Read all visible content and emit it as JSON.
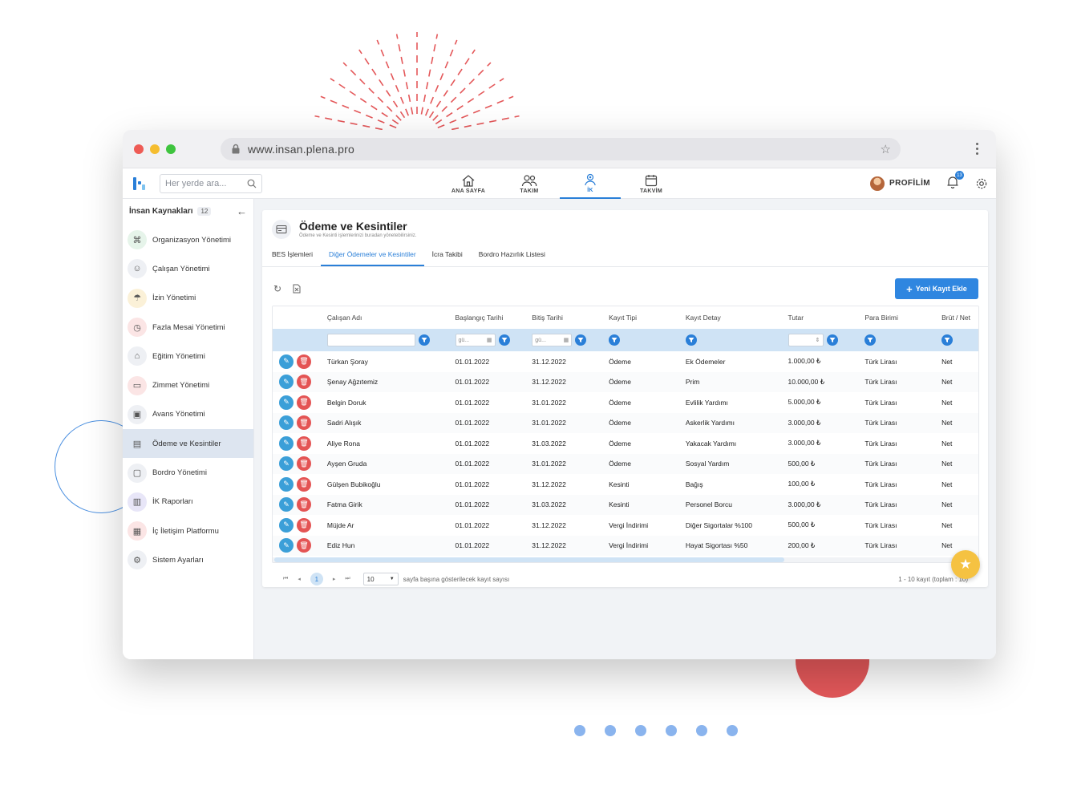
{
  "browser": {
    "url": "www.insan.plena.pro",
    "traffic_colors": [
      "#ee5b55",
      "#f5bd2f",
      "#3ec43e"
    ]
  },
  "search": {
    "placeholder": "Her yerde ara..."
  },
  "nav": {
    "items": [
      {
        "label": "ANA SAYFA",
        "icon": "home-icon",
        "active": false
      },
      {
        "label": "TAKIM",
        "icon": "team-icon",
        "active": false
      },
      {
        "label": "İK",
        "icon": "hr-icon",
        "active": true
      },
      {
        "label": "TAKVİM",
        "icon": "calendar-icon",
        "active": false
      }
    ]
  },
  "header": {
    "profile_label": "PROFİLİM",
    "notification_count": "13"
  },
  "sidebar": {
    "title": "İnsan Kaynakları",
    "count": "12",
    "items": [
      {
        "label": "Organizasyon Yönetimi",
        "icon": "org-chart-icon"
      },
      {
        "label": "Çalışan Yönetimi",
        "icon": "employees-icon"
      },
      {
        "label": "İzin Yönetimi",
        "icon": "umbrella-icon"
      },
      {
        "label": "Fazla Mesai Yönetimi",
        "icon": "clock-icon"
      },
      {
        "label": "Eğitim Yönetimi",
        "icon": "graduation-cap-icon"
      },
      {
        "label": "Zimmet Yönetimi",
        "icon": "devices-icon"
      },
      {
        "label": "Avans Yönetimi",
        "icon": "cash-icon"
      },
      {
        "label": "Ödeme ve Kesintiler",
        "icon": "payment-card-icon",
        "active": true
      },
      {
        "label": "Bordro Yönetimi",
        "icon": "payroll-icon"
      },
      {
        "label": "İK Raporları",
        "icon": "bar-chart-icon"
      },
      {
        "label": "İç İletişim Platformu",
        "icon": "communication-icon"
      },
      {
        "label": "Sistem Ayarları",
        "icon": "gear-icon"
      }
    ]
  },
  "page": {
    "title": "Ödeme ve Kesintiler",
    "subtitle": "Ödeme ve Kesinti işlemlerinizi buradan yönetebilirsiniz.",
    "tabs": [
      {
        "label": "BES İşlemleri",
        "active": false
      },
      {
        "label": "Diğer Ödemeler ve Kesintiler",
        "active": true
      },
      {
        "label": "İcra Takibi",
        "active": false
      },
      {
        "label": "Bordro Hazırlık Listesi",
        "active": false
      }
    ],
    "add_button": "Yeni Kayıt Ekle"
  },
  "table": {
    "columns": [
      "Çalışan Adı",
      "Başlangıç Tarihi",
      "Bitiş Tarihi",
      "Kayıt Tipi",
      "Kayıt Detay",
      "Tutar",
      "Para Birimi",
      "Brüt / Net"
    ],
    "date_filter_placeholder": "gü...",
    "rows": [
      [
        "Türkan Şoray",
        "01.01.2022",
        "31.12.2022",
        "Ödeme",
        "Ek Ödemeler",
        "1.000,00 ₺",
        "Türk Lirası",
        "Net"
      ],
      [
        "Şenay Ağzıtemiz",
        "01.01.2022",
        "31.12.2022",
        "Ödeme",
        "Prim",
        "10.000,00 ₺",
        "Türk Lirası",
        "Net"
      ],
      [
        "Belgin Doruk",
        "01.01.2022",
        "31.01.2022",
        "Ödeme",
        "Evlilik Yardımı",
        "5.000,00 ₺",
        "Türk Lirası",
        "Net"
      ],
      [
        "Sadri Alışık",
        "01.01.2022",
        "31.01.2022",
        "Ödeme",
        "Askerlik Yardımı",
        "3.000,00 ₺",
        "Türk Lirası",
        "Net"
      ],
      [
        "Aliye Rona",
        "01.01.2022",
        "31.03.2022",
        "Ödeme",
        "Yakacak Yardımı",
        "3.000,00 ₺",
        "Türk Lirası",
        "Net"
      ],
      [
        "Ayşen Gruda",
        "01.01.2022",
        "31.01.2022",
        "Ödeme",
        "Sosyal Yardım",
        "500,00 ₺",
        "Türk Lirası",
        "Net"
      ],
      [
        "Gülşen Bubikoğlu",
        "01.01.2022",
        "31.12.2022",
        "Kesinti",
        "Bağış",
        "100,00 ₺",
        "Türk Lirası",
        "Net"
      ],
      [
        "Fatma Girik",
        "01.01.2022",
        "31.03.2022",
        "Kesinti",
        "Personel Borcu",
        "3.000,00 ₺",
        "Türk Lirası",
        "Net"
      ],
      [
        "Müjde Ar",
        "01.01.2022",
        "31.12.2022",
        "Vergi İndirimi",
        "Diğer Sigortalar %100",
        "500,00 ₺",
        "Türk Lirası",
        "Net"
      ],
      [
        "Ediz Hun",
        "01.01.2022",
        "31.12.2022",
        "Vergi İndirimi",
        "Hayat Sigortası %50",
        "200,00 ₺",
        "Türk Lirası",
        "Net"
      ]
    ]
  },
  "pager": {
    "current_page": "1",
    "page_size": "10",
    "page_size_label": "sayfa başına gösterilecek kayıt sayısı",
    "total_label": "1 - 10 kayıt (toplam : 10)"
  },
  "colors": {
    "accent": "#2a7fd8",
    "danger": "#e45454",
    "star": "#f5c242"
  }
}
